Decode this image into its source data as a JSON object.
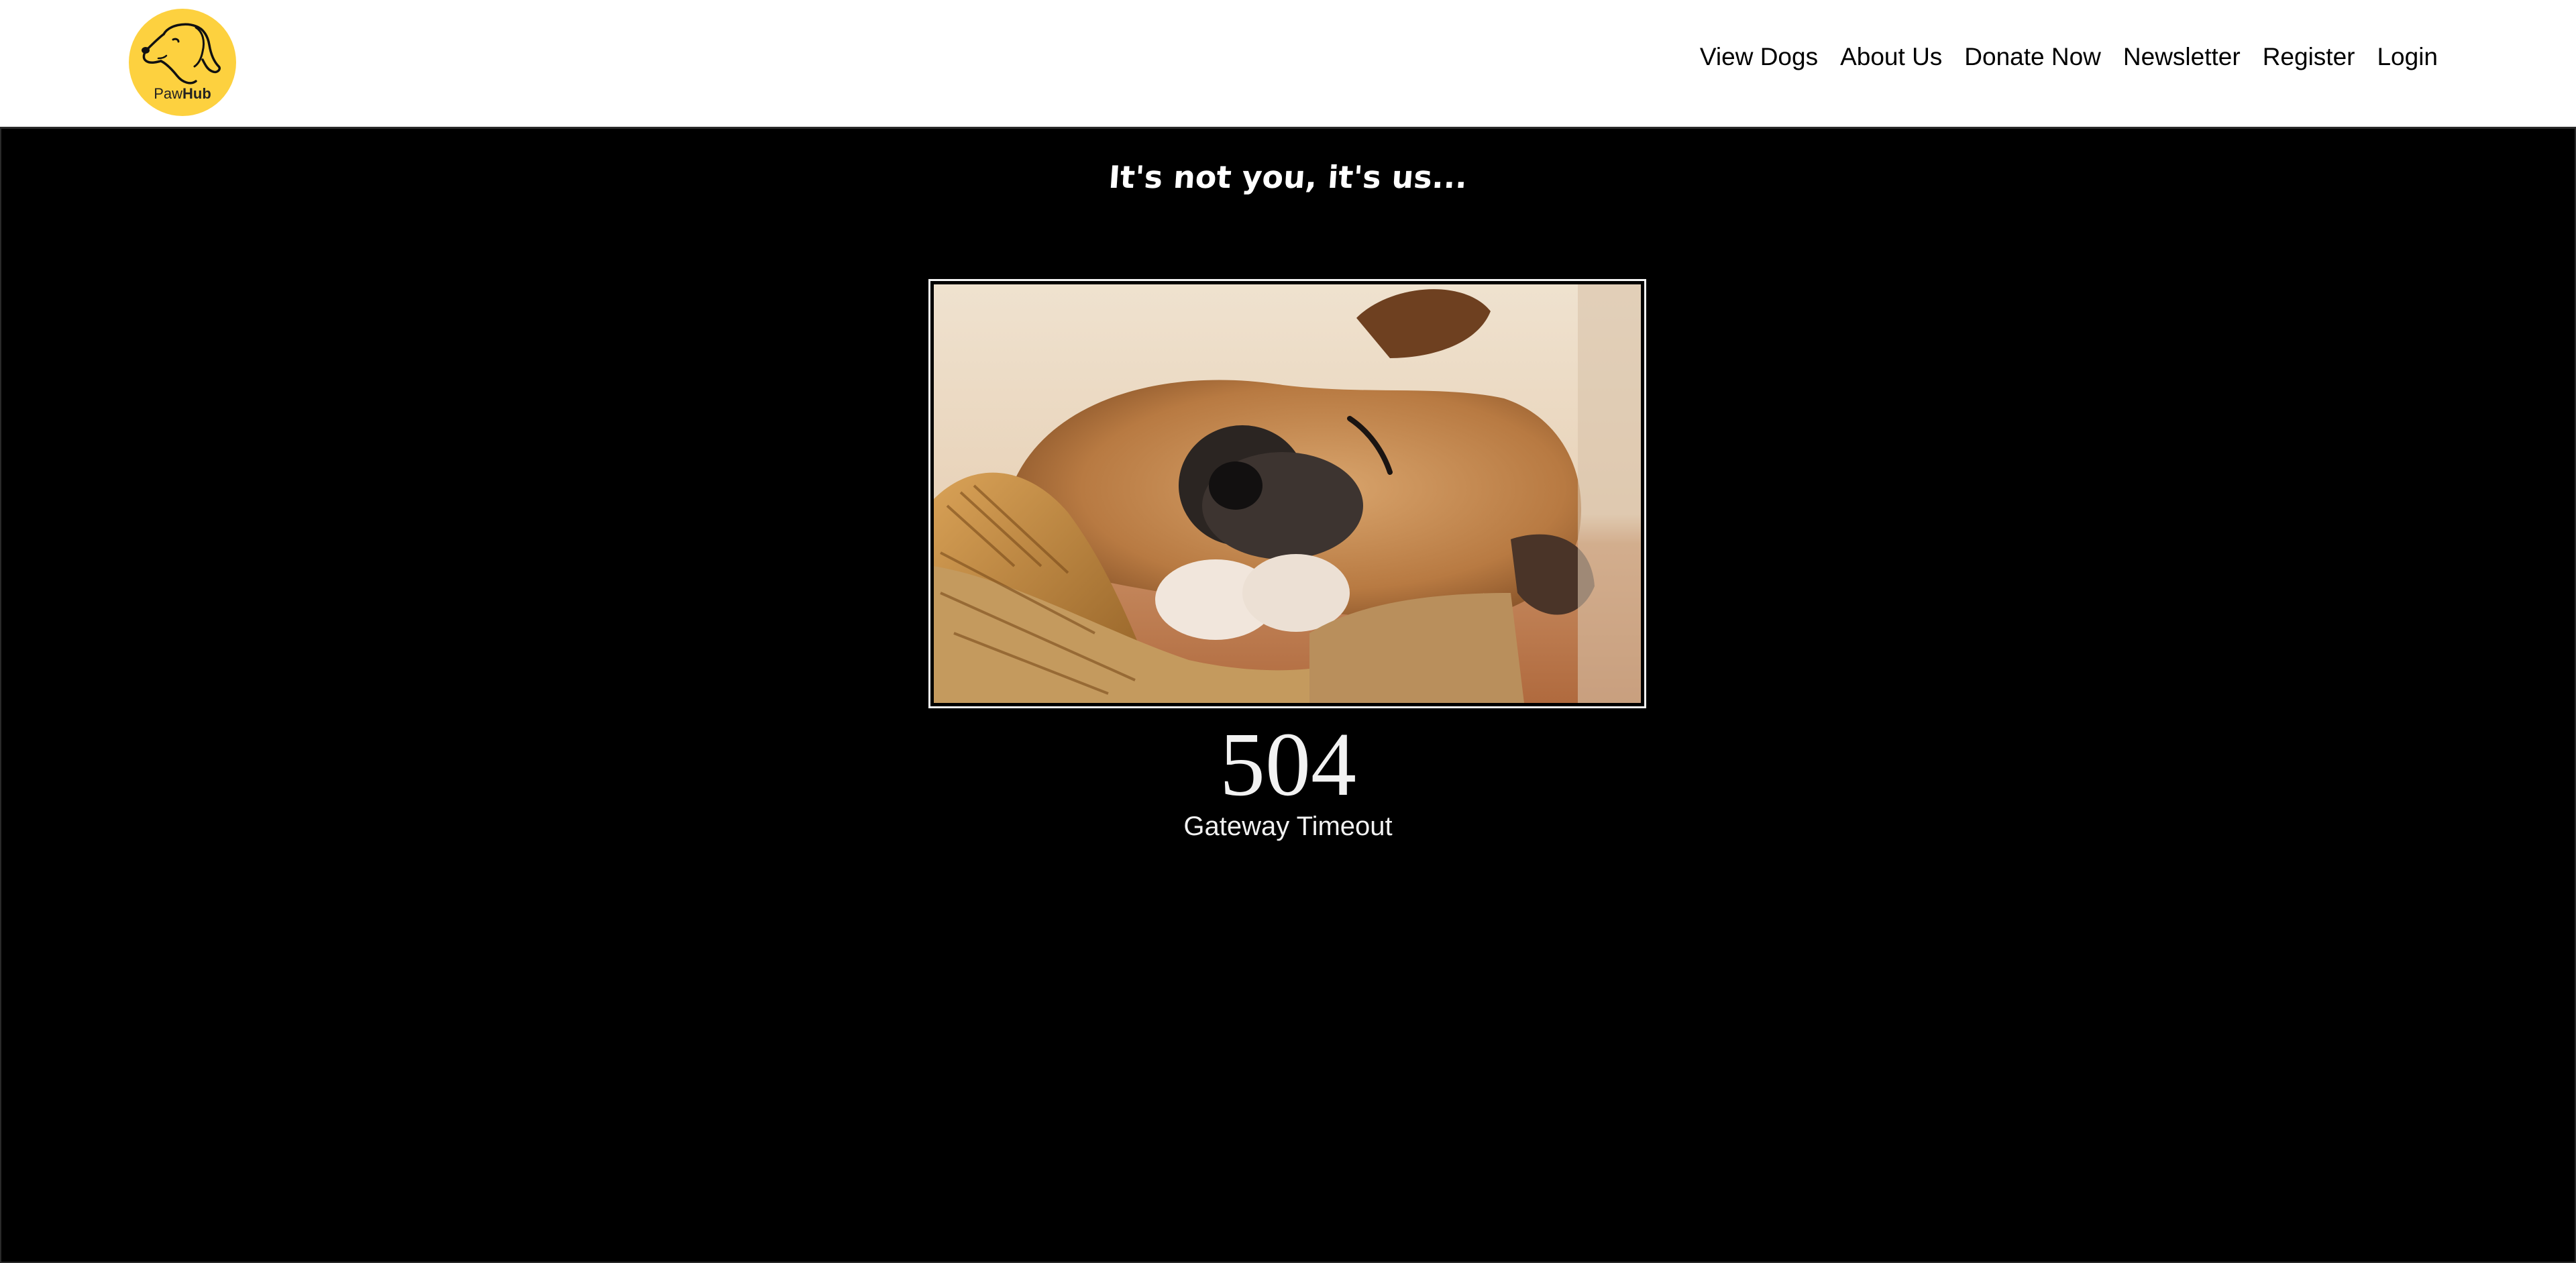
{
  "brand": {
    "name_light": "Paw",
    "name_bold": "Hub",
    "logo_color": "#fdd13f"
  },
  "nav": {
    "items": [
      {
        "label": "View Dogs"
      },
      {
        "label": "About Us"
      },
      {
        "label": "Donate Now"
      },
      {
        "label": "Newsletter"
      },
      {
        "label": "Register"
      },
      {
        "label": "Login"
      }
    ]
  },
  "error": {
    "headline": "It's not you, it's us...",
    "code": "504",
    "message": "Gateway Timeout"
  },
  "colors": {
    "page_bg": "#000000",
    "header_bg": "#ffffff",
    "text_light": "#f2f2f2"
  },
  "icons": {
    "logo": "dog-head-icon"
  }
}
